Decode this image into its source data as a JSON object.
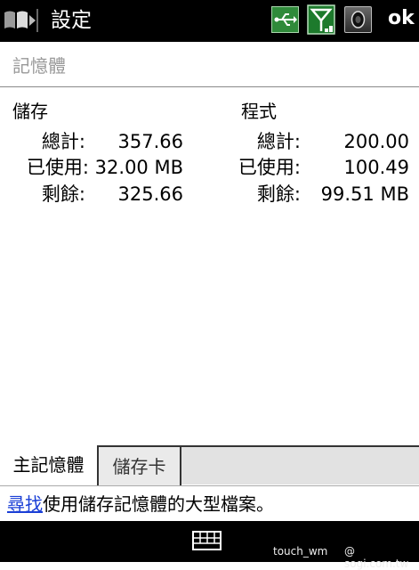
{
  "topbar": {
    "title": "設定",
    "ok_label": "ok"
  },
  "subtitle": "記憶體",
  "storage": {
    "heading": "儲存",
    "total_label": "總計:",
    "total_value": "357.66",
    "used_label": "已使用:",
    "used_value": "32.00 MB",
    "free_label": "剩餘:",
    "free_value": "325.66"
  },
  "program": {
    "heading": "程式",
    "total_label": "總計:",
    "total_value": "200.00",
    "used_label": "已使用:",
    "used_value": "100.49",
    "free_label": "剩餘:",
    "free_value": "99.51 MB"
  },
  "tabs": [
    {
      "label": "主記憶體",
      "active": true
    },
    {
      "label": "儲存卡",
      "active": false
    }
  ],
  "find_line": {
    "link_text": "尋找",
    "rest_text": "使用儲存記憶體的大型檔案。"
  },
  "watermark": {
    "left": "touch_wm",
    "right": "@ sogi.com.tw"
  },
  "colors": {
    "bar_bg": "#000000",
    "link": "#1a3fd6",
    "usb_icon_bg": "#2f8a3a"
  },
  "icons": [
    "windows-start-icon",
    "usb-icon",
    "signal-icon",
    "volume-icon",
    "keyboard-icon"
  ]
}
